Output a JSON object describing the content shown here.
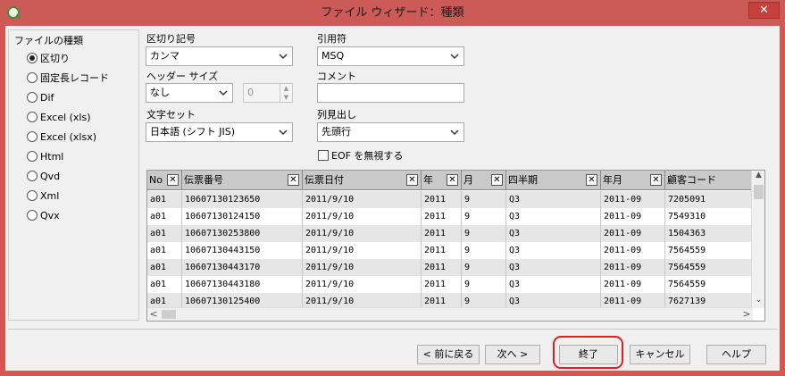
{
  "window": {
    "title": "ファイル ウィザード：種類",
    "close_glyph": "✕"
  },
  "file_type": {
    "group_label": "ファイルの種類",
    "options": [
      {
        "label": "区切り",
        "checked": true
      },
      {
        "label": "固定長レコード",
        "checked": false
      },
      {
        "label": "Dif",
        "checked": false
      },
      {
        "label": "Excel (xls)",
        "checked": false
      },
      {
        "label": "Excel (xlsx)",
        "checked": false
      },
      {
        "label": "Html",
        "checked": false
      },
      {
        "label": "Qvd",
        "checked": false
      },
      {
        "label": "Xml",
        "checked": false
      },
      {
        "label": "Qvx",
        "checked": false
      }
    ]
  },
  "delimiter": {
    "label": "区切り記号",
    "value": "カンマ"
  },
  "header_size": {
    "label": "ヘッダー サイズ",
    "value": "なし",
    "spin_value": "0"
  },
  "charset": {
    "label": "文字セット",
    "value": "日本語 (シフト JIS)"
  },
  "quote": {
    "label": "引用符",
    "value": "MSQ"
  },
  "comment": {
    "label": "コメント",
    "value": ""
  },
  "column_labels": {
    "label": "列見出し",
    "value": "先頭行"
  },
  "ignore_eof": {
    "label": "EOF を無視する",
    "checked": false
  },
  "table": {
    "columns": [
      "No",
      "伝票番号",
      "伝票日付",
      "年",
      "月",
      "四半期",
      "年月",
      "顧客コード"
    ],
    "close_glyph": "✕",
    "rows": [
      [
        "a01",
        "10607130123650",
        "2011/9/10",
        "2011",
        "9",
        "Q3",
        "2011-09",
        "7205091"
      ],
      [
        "a01",
        "10607130124150",
        "2011/9/10",
        "2011",
        "9",
        "Q3",
        "2011-09",
        "7549310"
      ],
      [
        "a01",
        "10607130253800",
        "2011/9/10",
        "2011",
        "9",
        "Q3",
        "2011-09",
        "1504363"
      ],
      [
        "a01",
        "10607130443150",
        "2011/9/10",
        "2011",
        "9",
        "Q3",
        "2011-09",
        "7564559"
      ],
      [
        "a01",
        "10607130443170",
        "2011/9/10",
        "2011",
        "9",
        "Q3",
        "2011-09",
        "7564559"
      ],
      [
        "a01",
        "10607130443180",
        "2011/9/10",
        "2011",
        "9",
        "Q3",
        "2011-09",
        "7564559"
      ],
      [
        "a01",
        "10607130125400",
        "2011/9/10",
        "2011",
        "9",
        "Q3",
        "2011-09",
        "7627139"
      ]
    ],
    "scroll_up": "▲",
    "scroll_down": "⌄",
    "scroll_left": "<",
    "scroll_right": ">"
  },
  "buttons": {
    "back": "< 前に戻る",
    "next": "次へ >",
    "finish": "終了",
    "cancel": "キャンセル",
    "help": "ヘルプ"
  }
}
